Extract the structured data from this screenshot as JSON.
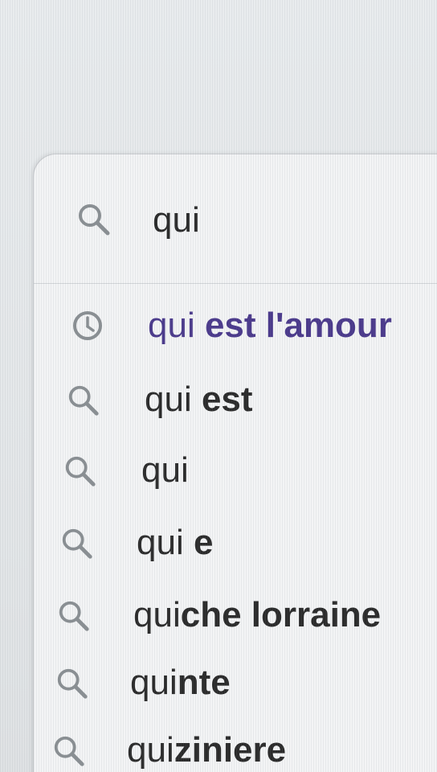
{
  "search": {
    "query": "qui"
  },
  "suggestions": [
    {
      "typed": "qui",
      "rest": " est l'amour",
      "icon": "history-clock-icon",
      "kind": "history"
    },
    {
      "typed": "qui",
      "rest": " est",
      "icon": "search-icon",
      "kind": "suggestion"
    },
    {
      "typed": "qui",
      "rest": "",
      "icon": "search-icon",
      "kind": "suggestion"
    },
    {
      "typed": "qui",
      "rest": " e",
      "icon": "search-icon",
      "kind": "suggestion"
    },
    {
      "typed": "qui",
      "rest": "che lorraine",
      "icon": "search-icon",
      "kind": "suggestion"
    },
    {
      "typed": "qui",
      "rest": "nte",
      "icon": "search-icon",
      "kind": "suggestion"
    },
    {
      "typed": "qui",
      "rest": "ziniere",
      "icon": "search-icon",
      "kind": "suggestion"
    }
  ],
  "colors": {
    "history_text": "#4b3a8c",
    "suggestion_text": "#2b2b2b",
    "icon": "#8a8f93",
    "panel": "#f3f4f5"
  }
}
